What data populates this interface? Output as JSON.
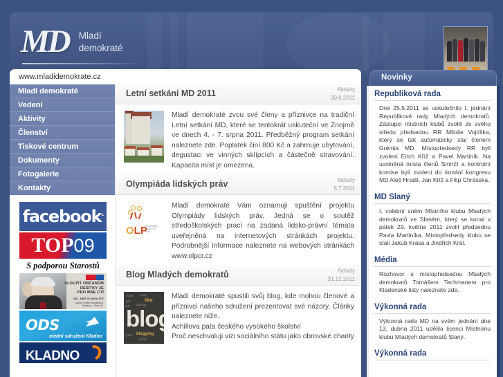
{
  "site": {
    "logo_initials": "MD",
    "logo_title_line1": "Mladí",
    "logo_title_line2": "demokraté",
    "url_tab": "www.mladidemokrate.cz",
    "news_tab": "Novinky",
    "header_photo_alt": "group-photo"
  },
  "sidebar": {
    "menu": [
      {
        "label": "Mladí demokraté"
      },
      {
        "label": "Vedení"
      },
      {
        "label": "Aktivity"
      },
      {
        "label": "Členství"
      },
      {
        "label": "Tiskové centrum"
      },
      {
        "label": "Dokumenty"
      },
      {
        "label": "Fotogalerie"
      },
      {
        "label": "Kontakty"
      }
    ],
    "banners": [
      {
        "id": "facebook",
        "text": "facebook",
        "mark": "."
      },
      {
        "id": "top09",
        "text": "TOP",
        "suffix": "09"
      },
      {
        "id": "starostove",
        "text": "S podporou Starostů"
      },
      {
        "id": "kampan",
        "line1": "SLOUŽIT OBČANŮM",
        "line2": "DESÍTKY JE",
        "line3": "PRO MNE CTÍ",
        "line4": "VÍC, NEŽ SI MYSLÍTE",
        "sig": "Jaromír Chlíbec\nKandidát na Senátora – Obvod 30"
      },
      {
        "id": "ods",
        "text": "ODS",
        "sub": "místní sdružení Kladno"
      },
      {
        "id": "kladno",
        "text": "KLADNO"
      }
    ]
  },
  "articles": [
    {
      "title": "Letní setkání MD 2011",
      "category": "Aktivity",
      "date": "30.6.2011",
      "thumb": "znojmo-church-photo",
      "text": "Mladí demokraté zvou své členy a příznivce na tradiční Letní setkání MD, které se tentokrát uskuteční ve Znojmě ve dnech 4. - 7. srpna 2011. Předběžný program setkání naleznete zde. Poplatek činí 800 Kč a zahrnuje ubytování, degustaci ve vinných sklípcích a částečně stravování. Kapacita míst je omezena."
    },
    {
      "title": "Olympiáda lidských práv",
      "category": "Aktivity",
      "date": "5.7.2011",
      "thumb": "olp-logo",
      "text": "Mladí demokraté Vám oznamuji spuštění projektu Olympiády lidských práv. Jedná se o soutěž středoškolských prací na zadaná lidsko-právní témata uveřejněná na internetových stránkách projektu. Podrobnější informace naleznete na webových stránkách www.olpcr.cz"
    },
    {
      "title": "Blog Mladých demokratů",
      "category": "Aktivity",
      "date": "31.12.2011",
      "thumb": "blog-wordcloud",
      "text": "Mladí demokraté spustili svůj blog, kde mohou členové a příznivci našeho sdružení prezentovat své názory. Články naleznete níže.",
      "text2": "Achillova pata českého vysokého školství",
      "text3": "Proč neschvaluji vizi sociálního státu jako obrovské charity"
    }
  ],
  "news": [
    {
      "heading": "Republiková rada",
      "body": "Dne 25.5.2011 se uskutečnilo I. jednání Republikové rady Mladých demokratů. Zástupci místních klubů zvolili ze svého středu předsedou RR Miloše Vojtíška, který se tak automaticky stal členem Grémia MD. Místopředsedy RR byli zvoleni Erich Kříž a Pavel Martiník. Na uvolněná místa členů Smírčí a kontrolní komise byli zvoleni do konání kongresu MD Aleš Hradil, Jan Kříž a Filip Chrásska."
    },
    {
      "heading": "MD Slaný",
      "body": "I. volební sněm Místního klubu Mladých demokratů ve Slaném, který se konal v pátek 29. května 2011 zvolil předsedou Pavla Martiníka. Místopředsedy klubu se stali Jakub Krása a Jindřich Král."
    },
    {
      "heading": "Média",
      "body": "Rozhovor s místopředsedou Mladých demokratů Tomášem Techmanem pro Kladenské listy naleznete zde."
    },
    {
      "heading": "Výkonná rada",
      "body": "Výkonná rada MD na svém jednání dne 13. dubna 2011 udělila licenci Místnímu klubu Mladých demokratů Slaný."
    },
    {
      "heading": "Výkonná rada",
      "body": ""
    }
  ],
  "colors": {
    "page_background": "#3c5280",
    "banner_blue": "#4b6191",
    "menu_blue": "#7083ad",
    "heading_blue": "#2c4577",
    "facebook_blue": "#3b5998",
    "top09_red": "#d8182b",
    "ods_cyan": "#1fa3dd"
  }
}
